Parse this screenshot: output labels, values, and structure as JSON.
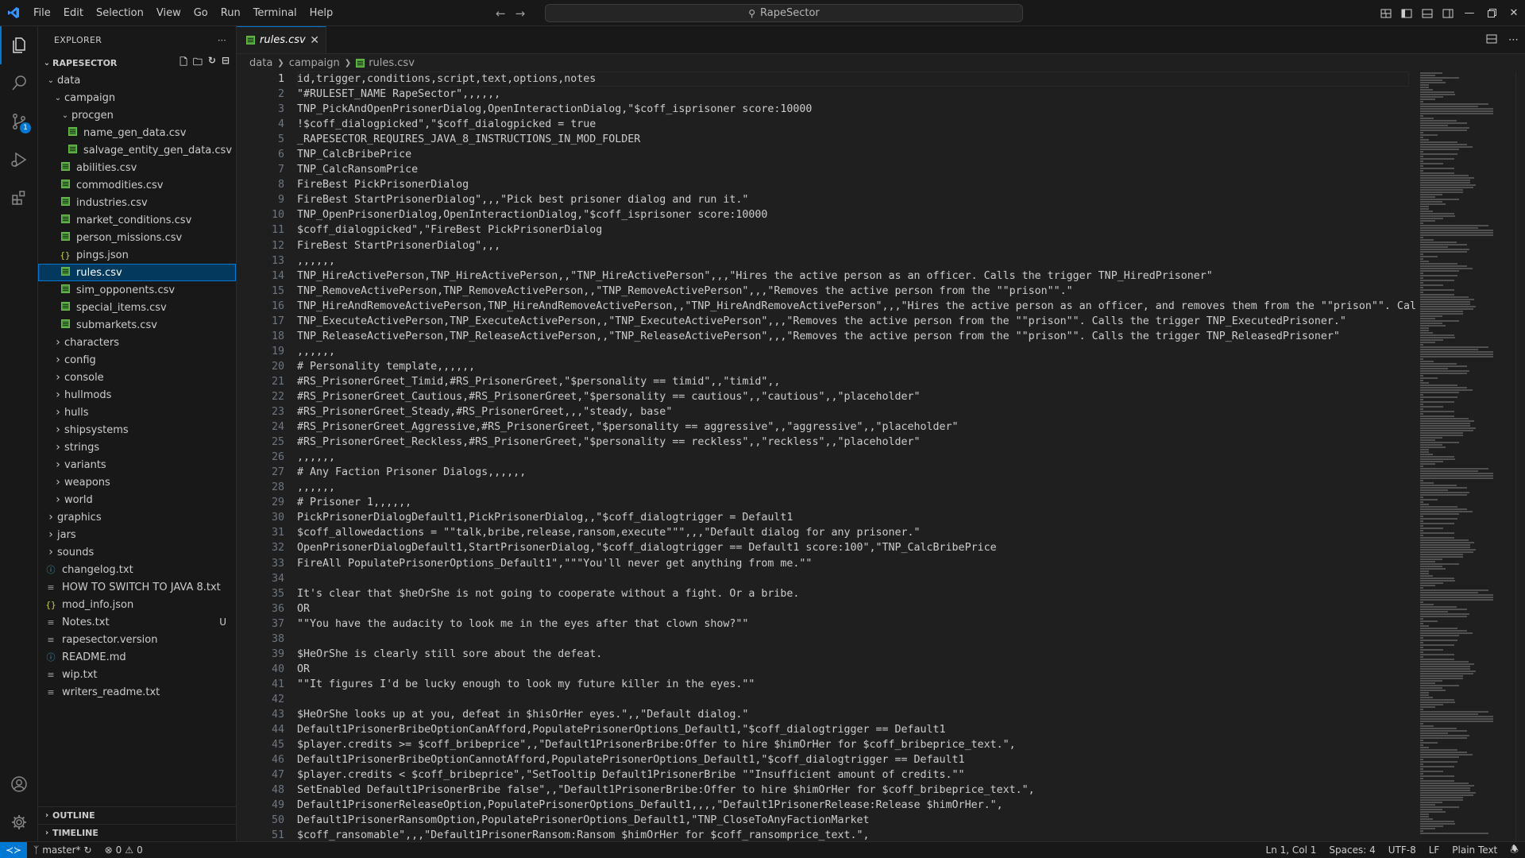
{
  "titlebar": {
    "menus": [
      "File",
      "Edit",
      "Selection",
      "View",
      "Go",
      "Run",
      "Terminal",
      "Help"
    ],
    "command_center": "RapeSector"
  },
  "activity": {
    "scm_badge": "1"
  },
  "sidebar": {
    "title": "EXPLORER",
    "root": "RAPESECTOR",
    "tree": [
      {
        "depth": 1,
        "kind": "folder-open",
        "label": "data"
      },
      {
        "depth": 2,
        "kind": "folder-open",
        "label": "campaign"
      },
      {
        "depth": 3,
        "kind": "folder-open",
        "label": "procgen"
      },
      {
        "depth": 4,
        "kind": "csv",
        "label": "name_gen_data.csv"
      },
      {
        "depth": 4,
        "kind": "csv",
        "label": "salvage_entity_gen_data.csv"
      },
      {
        "depth": 3,
        "kind": "csv",
        "label": "abilities.csv"
      },
      {
        "depth": 3,
        "kind": "csv",
        "label": "commodities.csv"
      },
      {
        "depth": 3,
        "kind": "csv",
        "label": "industries.csv"
      },
      {
        "depth": 3,
        "kind": "csv",
        "label": "market_conditions.csv"
      },
      {
        "depth": 3,
        "kind": "csv",
        "label": "person_missions.csv"
      },
      {
        "depth": 3,
        "kind": "json",
        "label": "pings.json"
      },
      {
        "depth": 3,
        "kind": "csv",
        "label": "rules.csv",
        "selected": true
      },
      {
        "depth": 3,
        "kind": "csv",
        "label": "sim_opponents.csv"
      },
      {
        "depth": 3,
        "kind": "csv",
        "label": "special_items.csv"
      },
      {
        "depth": 3,
        "kind": "csv",
        "label": "submarkets.csv"
      },
      {
        "depth": 2,
        "kind": "folder",
        "label": "characters"
      },
      {
        "depth": 2,
        "kind": "folder",
        "label": "config"
      },
      {
        "depth": 2,
        "kind": "folder",
        "label": "console"
      },
      {
        "depth": 2,
        "kind": "folder",
        "label": "hullmods"
      },
      {
        "depth": 2,
        "kind": "folder",
        "label": "hulls"
      },
      {
        "depth": 2,
        "kind": "folder",
        "label": "shipsystems"
      },
      {
        "depth": 2,
        "kind": "folder",
        "label": "strings"
      },
      {
        "depth": 2,
        "kind": "folder",
        "label": "variants"
      },
      {
        "depth": 2,
        "kind": "folder",
        "label": "weapons"
      },
      {
        "depth": 2,
        "kind": "folder",
        "label": "world"
      },
      {
        "depth": 1,
        "kind": "folder",
        "label": "graphics"
      },
      {
        "depth": 1,
        "kind": "folder",
        "label": "jars"
      },
      {
        "depth": 1,
        "kind": "folder",
        "label": "sounds"
      },
      {
        "depth": 1,
        "kind": "info",
        "label": "changelog.txt"
      },
      {
        "depth": 1,
        "kind": "txt",
        "label": "HOW TO SWITCH TO JAVA 8.txt"
      },
      {
        "depth": 1,
        "kind": "json",
        "label": "mod_info.json"
      },
      {
        "depth": 1,
        "kind": "txt",
        "label": "Notes.txt",
        "badge": "U"
      },
      {
        "depth": 1,
        "kind": "txt",
        "label": "rapesector.version"
      },
      {
        "depth": 1,
        "kind": "info",
        "label": "README.md"
      },
      {
        "depth": 1,
        "kind": "txt",
        "label": "wip.txt"
      },
      {
        "depth": 1,
        "kind": "txt",
        "label": "writers_readme.txt"
      }
    ],
    "outline": "OUTLINE",
    "timeline": "TIMELINE"
  },
  "editor": {
    "tab": "rules.csv",
    "breadcrumb": [
      "data",
      "campaign",
      "rules.csv"
    ],
    "lines": [
      "id,trigger,conditions,script,text,options,notes",
      "\"#RULESET_NAME RapeSector\",,,,,,",
      "TNP_PickAndOpenPrisonerDialog,OpenInteractionDialog,\"$coff_isprisoner score:10000",
      "!$coff_dialogpicked\",\"$coff_dialogpicked = true",
      "_RAPESECTOR_REQUIRES_JAVA_8_INSTRUCTIONS_IN_MOD_FOLDER",
      "TNP_CalcBribePrice",
      "TNP_CalcRansomPrice",
      "FireBest PickPrisonerDialog",
      "FireBest StartPrisonerDialog\",,,\"Pick best prisoner dialog and run it.\"",
      "TNP_OpenPrisonerDialog,OpenInteractionDialog,\"$coff_isprisoner score:10000",
      "$coff_dialogpicked\",\"FireBest PickPrisonerDialog",
      "FireBest StartPrisonerDialog\",,,",
      ",,,,,,",
      "TNP_HireActivePerson,TNP_HireActivePerson,,\"TNP_HireActivePerson\",,,\"Hires the active person as an officer. Calls the trigger TNP_HiredPrisoner\"",
      "TNP_RemoveActivePerson,TNP_RemoveActivePerson,,\"TNP_RemoveActivePerson\",,,\"Removes the active person from the \"\"prison\"\".\"",
      "TNP_HireAndRemoveActivePerson,TNP_HireAndRemoveActivePerson,,\"TNP_HireAndRemoveActivePerson\",,,\"Hires the active person as an officer, and removes them from the \"\"prison\"\". Cal",
      "TNP_ExecuteActivePerson,TNP_ExecuteActivePerson,,\"TNP_ExecuteActivePerson\",,,\"Removes the active person from the \"\"prison\"\". Calls the trigger TNP_ExecutedPrisoner.\"",
      "TNP_ReleaseActivePerson,TNP_ReleaseActivePerson,,\"TNP_ReleaseActivePerson\",,,\"Removes the active person from the \"\"prison\"\". Calls the trigger TNP_ReleasedPrisoner\"",
      ",,,,,,",
      "# Personality template,,,,,,",
      "#RS_PrisonerGreet_Timid,#RS_PrisonerGreet,\"$personality == timid\",,\"timid\",,",
      "#RS_PrisonerGreet_Cautious,#RS_PrisonerGreet,\"$personality == cautious\",,\"cautious\",,\"placeholder\"",
      "#RS_PrisonerGreet_Steady,#RS_PrisonerGreet,,,\"steady, base\"",
      "#RS_PrisonerGreet_Aggressive,#RS_PrisonerGreet,\"$personality == aggressive\",,\"aggressive\",,\"placeholder\"",
      "#RS_PrisonerGreet_Reckless,#RS_PrisonerGreet,\"$personality == reckless\",,\"reckless\",,\"placeholder\"",
      ",,,,,,",
      "# Any Faction Prisoner Dialogs,,,,,,",
      ",,,,,,",
      "# Prisoner 1,,,,,,",
      "PickPrisonerDialogDefault1,PickPrisonerDialog,,\"$coff_dialogtrigger = Default1",
      "$coff_allowedactions = \"\"talk,bribe,release,ransom,execute\"\"\",,,\"Default dialog for any prisoner.\"",
      "OpenPrisonerDialogDefault1,StartPrisonerDialog,\"$coff_dialogtrigger == Default1 score:100\",\"TNP_CalcBribePrice",
      "FireAll PopulatePrisonerOptions_Default1\",\"\"\"You'll never get anything from me.\"\"",
      "",
      "It's clear that $heOrShe is not going to cooperate without a fight. Or a bribe.",
      "OR",
      "\"\"You have the audacity to look me in the eyes after that clown show?\"\"",
      "",
      "$HeOrShe is clearly still sore about the defeat.",
      "OR",
      "\"\"It figures I'd be lucky enough to look my future killer in the eyes.\"\"",
      "",
      "$HeOrShe looks up at you, defeat in $hisOrHer eyes.\",,\"Default dialog.\"",
      "Default1PrisonerBribeOptionCanAfford,PopulatePrisonerOptions_Default1,\"$coff_dialogtrigger == Default1",
      "$player.credits >= $coff_bribeprice\",,\"Default1PrisonerBribe:Offer to hire $himOrHer for $coff_bribeprice_text.\",",
      "Default1PrisonerBribeOptionCannotAfford,PopulatePrisonerOptions_Default1,\"$coff_dialogtrigger == Default1",
      "$player.credits < $coff_bribeprice\",\"SetTooltip Default1PrisonerBribe \"\"Insufficient amount of credits.\"\"",
      "SetEnabled Default1PrisonerBribe false\",,\"Default1PrisonerBribe:Offer to hire $himOrHer for $coff_bribeprice_text.\",",
      "Default1PrisonerReleaseOption,PopulatePrisonerOptions_Default1,,,,\"Default1PrisonerRelease:Release $himOrHer.\",",
      "Default1PrisonerRansomOption,PopulatePrisonerOptions_Default1,\"TNP_CloseToAnyFactionMarket",
      "$coff_ransomable\",,,\"Default1PrisonerRansom:Ransom $himOrHer for $coff_ransomprice_text.\","
    ]
  },
  "statusbar": {
    "branch": "master*",
    "errors": "0",
    "warnings": "0",
    "position": "Ln 1, Col 1",
    "spaces": "Spaces: 4",
    "encoding": "UTF-8",
    "eol": "LF",
    "language": "Plain Text"
  },
  "colors": {
    "accent": "#0078d4",
    "selection": "#04395e",
    "csv_icon": "#4e9a3c",
    "json_icon": "#cbcb41"
  }
}
